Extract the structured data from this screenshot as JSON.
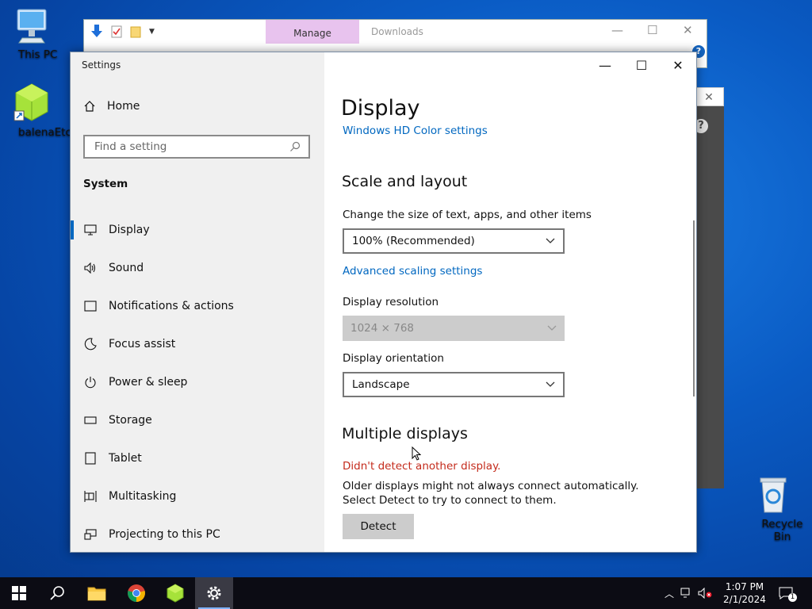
{
  "desktop": {
    "icons": [
      {
        "label": "This PC"
      },
      {
        "label": "balenaEtcher"
      },
      {
        "label": "Recycle Bin"
      }
    ]
  },
  "explorer": {
    "manage_tab": "Manage",
    "title": "Downloads"
  },
  "settings": {
    "window_title": "Settings",
    "home_label": "Home",
    "search_placeholder": "Find a setting",
    "section_label": "System",
    "nav_items": [
      {
        "label": "Display",
        "icon": "monitor-icon",
        "active": true
      },
      {
        "label": "Sound",
        "icon": "speaker-icon"
      },
      {
        "label": "Notifications & actions",
        "icon": "notification-icon"
      },
      {
        "label": "Focus assist",
        "icon": "moon-icon"
      },
      {
        "label": "Power & sleep",
        "icon": "power-icon"
      },
      {
        "label": "Storage",
        "icon": "storage-icon"
      },
      {
        "label": "Tablet",
        "icon": "tablet-icon"
      },
      {
        "label": "Multitasking",
        "icon": "multitasking-icon"
      },
      {
        "label": "Projecting to this PC",
        "icon": "projecting-icon"
      }
    ],
    "content": {
      "page_title": "Display",
      "hd_color_link": "Windows HD Color settings",
      "scale_heading": "Scale and layout",
      "scale_label": "Change the size of text, apps, and other items",
      "scale_value": "100% (Recommended)",
      "advanced_scaling_link": "Advanced scaling settings",
      "resolution_label": "Display resolution",
      "resolution_value": "1024 × 768",
      "orientation_label": "Display orientation",
      "orientation_value": "Landscape",
      "multiple_heading": "Multiple displays",
      "error_text": "Didn't detect another display.",
      "info_text": "Older displays might not always connect automatically. Select Detect to try to connect to them.",
      "detect_button": "Detect"
    }
  },
  "taskbar": {
    "time": "1:07 PM",
    "date": "2/1/2024",
    "notification_count": "1"
  },
  "colors": {
    "accent": "#0067c0",
    "error": "#c42b1c"
  }
}
